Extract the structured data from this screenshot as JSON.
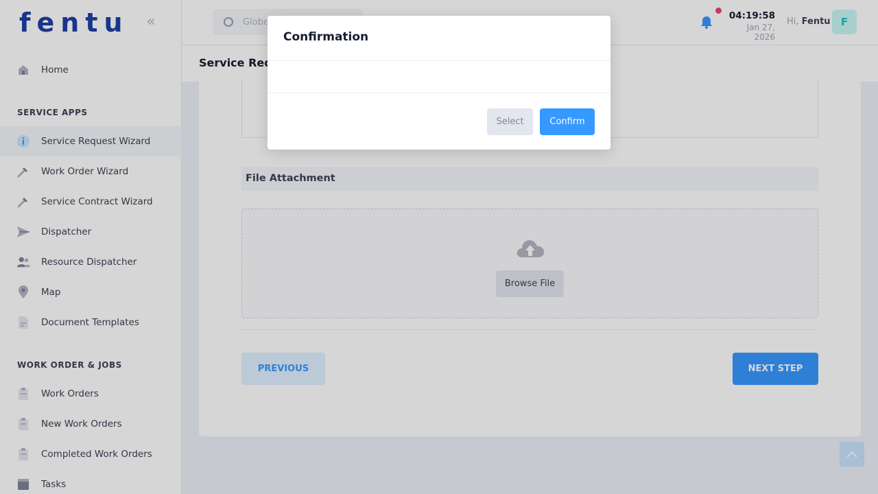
{
  "brand": {
    "logo_text": "fentu",
    "accent": "#3699ff",
    "logo_color": "#1e3fa8"
  },
  "sidebar": {
    "items": [
      {
        "label": "Home",
        "icon": "home-icon"
      },
      {
        "label": "Service Request Wizard",
        "icon": "info-icon"
      },
      {
        "label": "Work Order Wizard",
        "icon": "wrench-icon"
      },
      {
        "label": "Service Contract Wizard",
        "icon": "wrench-icon"
      },
      {
        "label": "Dispatcher",
        "icon": "send-icon"
      },
      {
        "label": "Resource Dispatcher",
        "icon": "users-icon"
      },
      {
        "label": "Map",
        "icon": "map-pin-icon"
      },
      {
        "label": "Document Templates",
        "icon": "document-icon"
      },
      {
        "label": "Work Orders",
        "icon": "clipboard-icon"
      },
      {
        "label": "New Work Orders",
        "icon": "clipboard-icon"
      },
      {
        "label": "Completed Work Orders",
        "icon": "clipboard-icon"
      },
      {
        "label": "Tasks",
        "icon": "tasks-icon"
      }
    ],
    "sections": [
      "SERVICE APPS",
      "WORK ORDER & JOBS"
    ],
    "active": "Service Request Wizard"
  },
  "header": {
    "search_placeholder": "Globe",
    "time": "04:19:58",
    "date": "Jan 27, 2026",
    "greeting": "Hi,",
    "user_name": "Fentu",
    "avatar_letter": "F"
  },
  "page": {
    "title": "Service Requ"
  },
  "form": {
    "file_section_title": "File Attachment",
    "browse_label": "Browse File",
    "previous_label": "PREVIOUS",
    "next_label": "NEXT STEP"
  },
  "modal": {
    "title": "Confirmation",
    "select_label": "Select",
    "confirm_label": "Confirm"
  }
}
